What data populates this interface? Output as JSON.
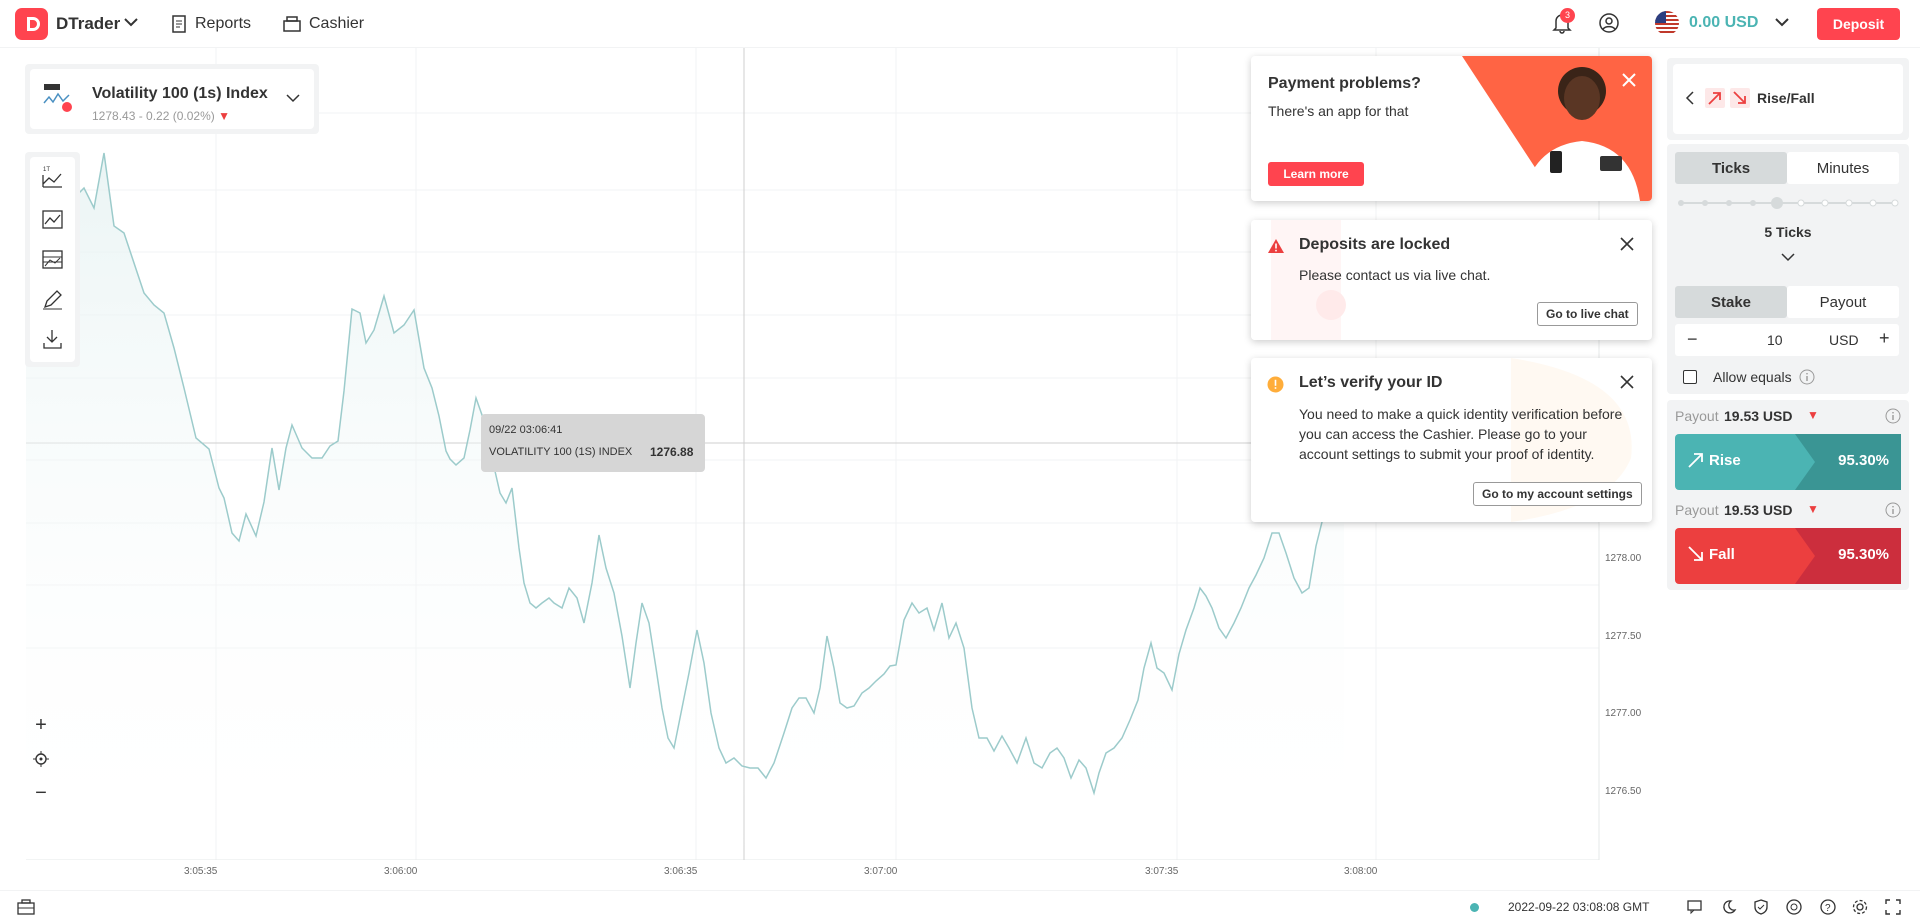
{
  "header": {
    "brand": "DTrader",
    "nav": [
      "Reports",
      "Cashier"
    ],
    "notification_count": "3",
    "balance": "0.00 USD",
    "deposit_label": "Deposit"
  },
  "symbol": {
    "name": "Volatility 100 (1s) Index",
    "price": "1278.43 - 0.22 (0.02%)"
  },
  "chart": {
    "price_labels": [
      "1278.00",
      "1277.50",
      "1277.00",
      "1276.50"
    ],
    "time_labels": [
      "3:05:35",
      "3:06:00",
      "3:06:35",
      "3:07:00",
      "3:07:35",
      "3:08:00"
    ],
    "tooltip": {
      "date": "09/22 03:06:41",
      "name": "VOLATILITY 100 (1S) INDEX",
      "value": "1276.88"
    }
  },
  "cards": {
    "payment": {
      "title": "Payment problems?",
      "text": "There's an app for that",
      "button": "Learn more"
    },
    "deposits": {
      "title": "Deposits are locked",
      "text": "Please contact us via live chat.",
      "button": "Go to live chat"
    },
    "verify": {
      "title": "Let’s verify your ID",
      "text": "You need to make a quick identity verification before you can access the Cashier. Please go to your account settings to submit your proof of identity.",
      "button": "Go to my account settings"
    }
  },
  "trade": {
    "contract_type": "Rise/Fall",
    "duration_tabs": [
      "Ticks",
      "Minutes"
    ],
    "duration_value": "5 Ticks",
    "amount_tabs": [
      "Stake",
      "Payout"
    ],
    "stake_value": "10",
    "currency": "USD",
    "allow_equals": "Allow equals",
    "rise": {
      "payout_label": "Payout",
      "payout_value": "19.53 USD",
      "label": "Rise",
      "percent": "95.30%"
    },
    "fall": {
      "payout_label": "Payout",
      "payout_value": "19.53 USD",
      "label": "Fall",
      "percent": "95.30%"
    }
  },
  "footer": {
    "datetime": "2022-09-22 03:08:08 GMT"
  },
  "colors": {
    "accent": "#ff444f",
    "rise": "#4bb4b3",
    "fall": "#ec3f3f",
    "line": "#9ccbcb"
  }
}
